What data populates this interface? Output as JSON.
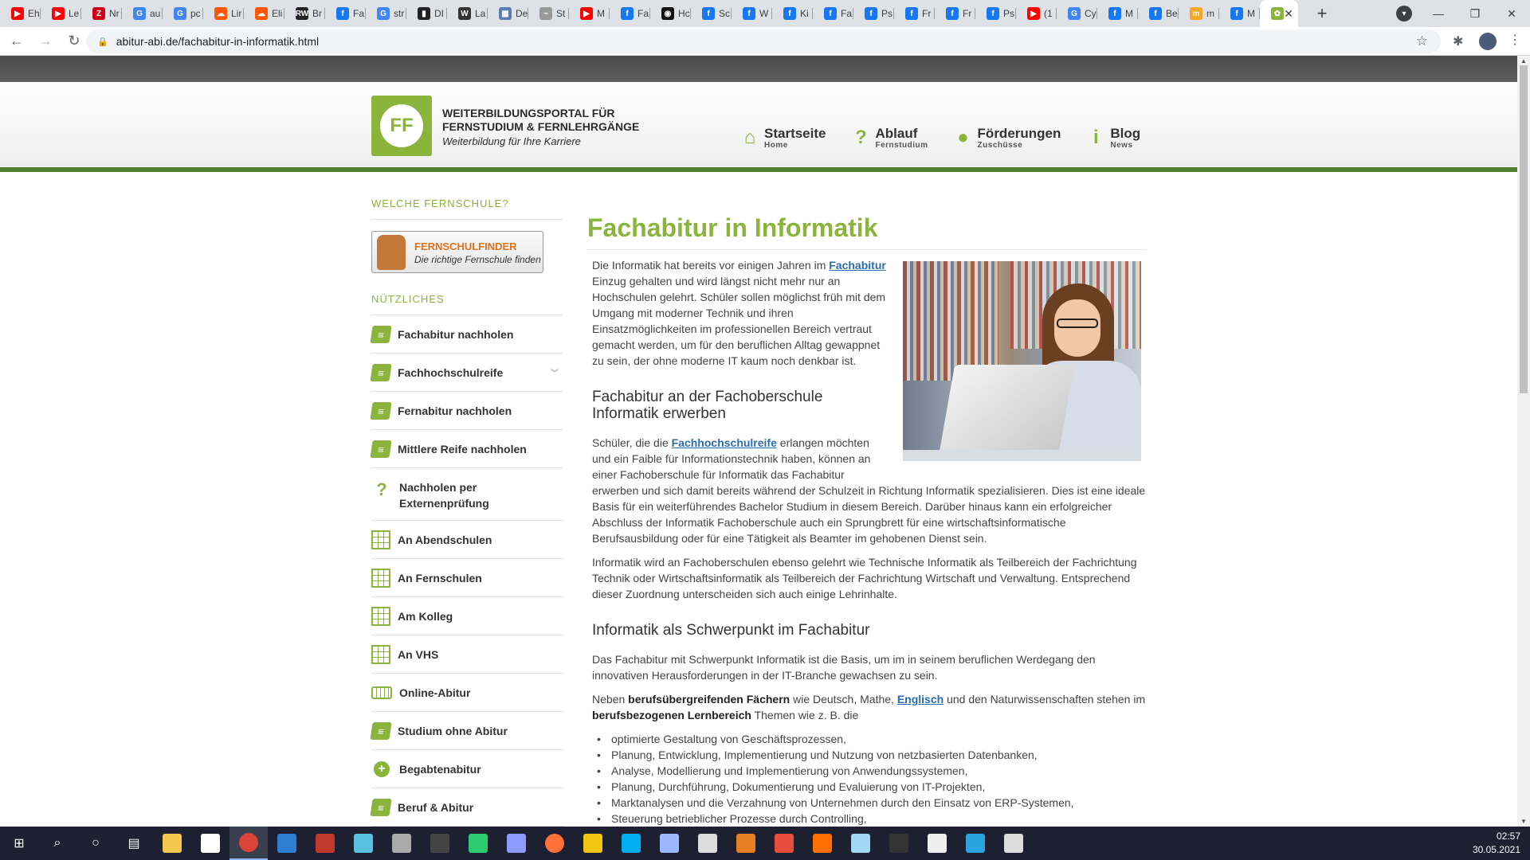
{
  "browser": {
    "tabs": [
      {
        "label": "Eh",
        "color": "#ff0000",
        "glyph": "▶"
      },
      {
        "label": "Le",
        "color": "#ff0000",
        "glyph": "▶"
      },
      {
        "label": "Nr",
        "color": "#d0021b",
        "glyph": "Z"
      },
      {
        "label": "au",
        "color": "#4285f4",
        "glyph": "G"
      },
      {
        "label": "pc",
        "color": "#4285f4",
        "glyph": "G"
      },
      {
        "label": "Lir",
        "color": "#ff5500",
        "glyph": "☁"
      },
      {
        "label": "Eli",
        "color": "#ff5500",
        "glyph": "☁"
      },
      {
        "label": "Br",
        "color": "#222222",
        "glyph": "RW"
      },
      {
        "label": "Fa",
        "color": "#1877f2",
        "glyph": "f"
      },
      {
        "label": "str",
        "color": "#4285f4",
        "glyph": "G"
      },
      {
        "label": "DI",
        "color": "#222222",
        "glyph": "▮"
      },
      {
        "label": "La",
        "color": "#333333",
        "glyph": "W"
      },
      {
        "label": "De",
        "color": "#5b7bb4",
        "glyph": "▦"
      },
      {
        "label": "St",
        "color": "#999999",
        "glyph": "~"
      },
      {
        "label": "M",
        "color": "#ff0000",
        "glyph": "▶"
      },
      {
        "label": "Fa",
        "color": "#1877f2",
        "glyph": "f"
      },
      {
        "label": "Hc",
        "color": "#111111",
        "glyph": "◉"
      },
      {
        "label": "Sc",
        "color": "#1877f2",
        "glyph": "f"
      },
      {
        "label": "W",
        "color": "#1877f2",
        "glyph": "f"
      },
      {
        "label": "Ki",
        "color": "#1877f2",
        "glyph": "f"
      },
      {
        "label": "Fa",
        "color": "#1877f2",
        "glyph": "f"
      },
      {
        "label": "Ps",
        "color": "#1877f2",
        "glyph": "f"
      },
      {
        "label": "Fr",
        "color": "#1877f2",
        "glyph": "f"
      },
      {
        "label": "Fr",
        "color": "#1877f2",
        "glyph": "f"
      },
      {
        "label": "Ps",
        "color": "#1877f2",
        "glyph": "f"
      },
      {
        "label": "(1",
        "color": "#ff0000",
        "glyph": "▶"
      },
      {
        "label": "Cy",
        "color": "#4285f4",
        "glyph": "G"
      },
      {
        "label": "M",
        "color": "#1877f2",
        "glyph": "f"
      },
      {
        "label": "Be",
        "color": "#1877f2",
        "glyph": "f"
      },
      {
        "label": "m",
        "color": "#f5a623",
        "glyph": "m"
      },
      {
        "label": "M",
        "color": "#1877f2",
        "glyph": "f"
      }
    ],
    "active_tab_color": "#8ab43b",
    "url": "abitur-abi.de/fachabitur-in-informatik.html"
  },
  "site": {
    "logo_text": "FF",
    "brand_line1": "WEITERBILDUNGSPORTAL FÜR",
    "brand_line2": "FERNSTUDIUM & FERNLEHRGÄNGE",
    "brand_tagline": "Weiterbildung für Ihre Karriere",
    "accent": "#8ab43b",
    "nav": [
      {
        "label": "Startseite",
        "sub": "Home",
        "icon": "⌂"
      },
      {
        "label": "Ablauf",
        "sub": "Fernstudium",
        "icon": "?"
      },
      {
        "label": "Förderungen",
        "sub": "Zuschüsse",
        "icon": "●"
      },
      {
        "label": "Blog",
        "sub": "News",
        "icon": "i"
      }
    ]
  },
  "sidebar": {
    "heading1": "WELCHE FERNSCHULE?",
    "finder_title": "FERNSCHULFINDER",
    "finder_sub": "Die richtige Fernschule finden",
    "heading2": "NÜTZLICHES",
    "items": [
      {
        "label": "Fachabitur nachholen",
        "icon": "book"
      },
      {
        "label": "Fachhochschulreife",
        "icon": "book"
      },
      {
        "label": "Fernabitur nachholen",
        "icon": "book"
      },
      {
        "label": "Mittlere Reife nachholen",
        "icon": "book"
      },
      {
        "label": "Nachholen per Externenprüfung",
        "icon": "question"
      },
      {
        "label": "An Abendschulen",
        "icon": "grid"
      },
      {
        "label": "An Fernschulen",
        "icon": "grid"
      },
      {
        "label": "Am Kolleg",
        "icon": "grid"
      },
      {
        "label": "An VHS",
        "icon": "grid"
      },
      {
        "label": "Online-Abitur",
        "icon": "keyboard"
      },
      {
        "label": "Studium ohne Abitur",
        "icon": "book"
      },
      {
        "label": "Begabtenabitur",
        "icon": "plus"
      },
      {
        "label": "Beruf & Abitur",
        "icon": "book"
      }
    ]
  },
  "article": {
    "title": "Fachabitur in Informatik",
    "p1_a": "Die Informatik hat bereits vor einigen Jahren im ",
    "p1_link": "Fachabitur",
    "p1_b": " Einzug gehalten und wird längst nicht mehr nur an Hochschulen gelehrt. Schüler sollen möglichst früh mit dem Umgang mit moderner Technik und ihren Einsatzmöglichkeiten im professionellen Bereich vertraut gemacht werden, um für den beruflichen Alltag gewappnet zu sein, der ohne moderne IT kaum noch denkbar ist.",
    "h2_1": "Fachabitur an der Fachoberschule Informatik erwerben",
    "p2_a": "Schüler, die die ",
    "p2_link": "Fachhochschulreife",
    "p2_b": " erlangen möchten und ein Faible für Informationstechnik haben, können an einer Fachoberschule für Informatik das Fachabitur erwerben und sich damit bereits während der Schulzeit in Richtung Informatik spezialisieren. Dies ist eine ideale Basis für ein weiterführendes Bachelor Studium in diesem Bereich. Darüber hinaus kann ein erfolgreicher Abschluss der Informatik Fachoberschule auch ein Sprungbrett für eine wirtschaftsinformatische Berufsausbildung oder für eine Tätigkeit als Beamter im gehobenen Dienst sein.",
    "p3": "Informatik wird an Fachoberschulen ebenso gelehrt wie Technische Informatik als Teilbereich der Fachrichtung Technik oder Wirtschaftsinformatik als Teilbereich der Fachrichtung Wirtschaft und Verwaltung. Entsprechend dieser Zuordnung unterscheiden sich auch einige Lehrinhalte.",
    "h2_2": "Informatik als Schwerpunkt im Fachabitur",
    "p4": "Das Fachabitur mit Schwerpunkt Informatik ist die Basis, um im in seinem beruflichen Werdegang den innovativen Herausforderungen in der IT-Branche gewachsen zu sein.",
    "p5_a": "Neben ",
    "p5_b1": "berufsübergreifenden Fächern",
    "p5_c": " wie Deutsch, Mathe, ",
    "p5_link": "Englisch",
    "p5_d": " und den Naturwissenschaften stehen im ",
    "p5_b2": "berufsbezogenen Lernbereich",
    "p5_e": " Themen wie z. B. die",
    "bullets": [
      "optimierte Gestaltung von Geschäftsprozessen,",
      "Planung, Entwicklung, Implementierung und Nutzung von netzbasierten Datenbanken,",
      "Analyse, Modellierung und Implementierung von Anwendungssystemen,",
      "Planung, Durchführung, Dokumentierung und Evaluierung von IT-Projekten,",
      "Marktanalysen und die Verzahnung von Unternehmen durch den Einsatz von ERP-Systemen,",
      "Steuerung betrieblicher Prozesse durch Controlling,"
    ]
  },
  "taskbar": {
    "time": "02:57",
    "date": "30.05.2021",
    "apps": [
      {
        "name": "file-explorer",
        "color": "#f2c94c"
      },
      {
        "name": "store",
        "color": "#ffffff"
      },
      {
        "name": "chrome",
        "color": "#db4437"
      },
      {
        "name": "app-blue",
        "color": "#2d7dd2"
      },
      {
        "name": "voicemeeter",
        "color": "#c0392b"
      },
      {
        "name": "app-teal",
        "color": "#5bc0de"
      },
      {
        "name": "app-globe",
        "color": "#aaaaaa"
      },
      {
        "name": "live",
        "color": "#444444"
      },
      {
        "name": "app-green",
        "color": "#2ecc71"
      },
      {
        "name": "app-arrow",
        "color": "#8e9aff"
      },
      {
        "name": "firefox",
        "color": "#ff7139"
      },
      {
        "name": "pen",
        "color": "#f1c40f"
      },
      {
        "name": "skype",
        "color": "#00aff0"
      },
      {
        "name": "app-cube",
        "color": "#9bb7ff"
      },
      {
        "name": "app-grey",
        "color": "#dddddd"
      },
      {
        "name": "app-orange",
        "color": "#e67e22"
      },
      {
        "name": "app-red",
        "color": "#e74c3c"
      },
      {
        "name": "app-ring",
        "color": "#ff6f00"
      },
      {
        "name": "app-bubble",
        "color": "#a3d8f4"
      },
      {
        "name": "terminal",
        "color": "#333333"
      },
      {
        "name": "notes",
        "color": "#eeeeee"
      },
      {
        "name": "telegram",
        "color": "#2aa3df"
      },
      {
        "name": "app-window",
        "color": "#dddddd"
      }
    ]
  }
}
